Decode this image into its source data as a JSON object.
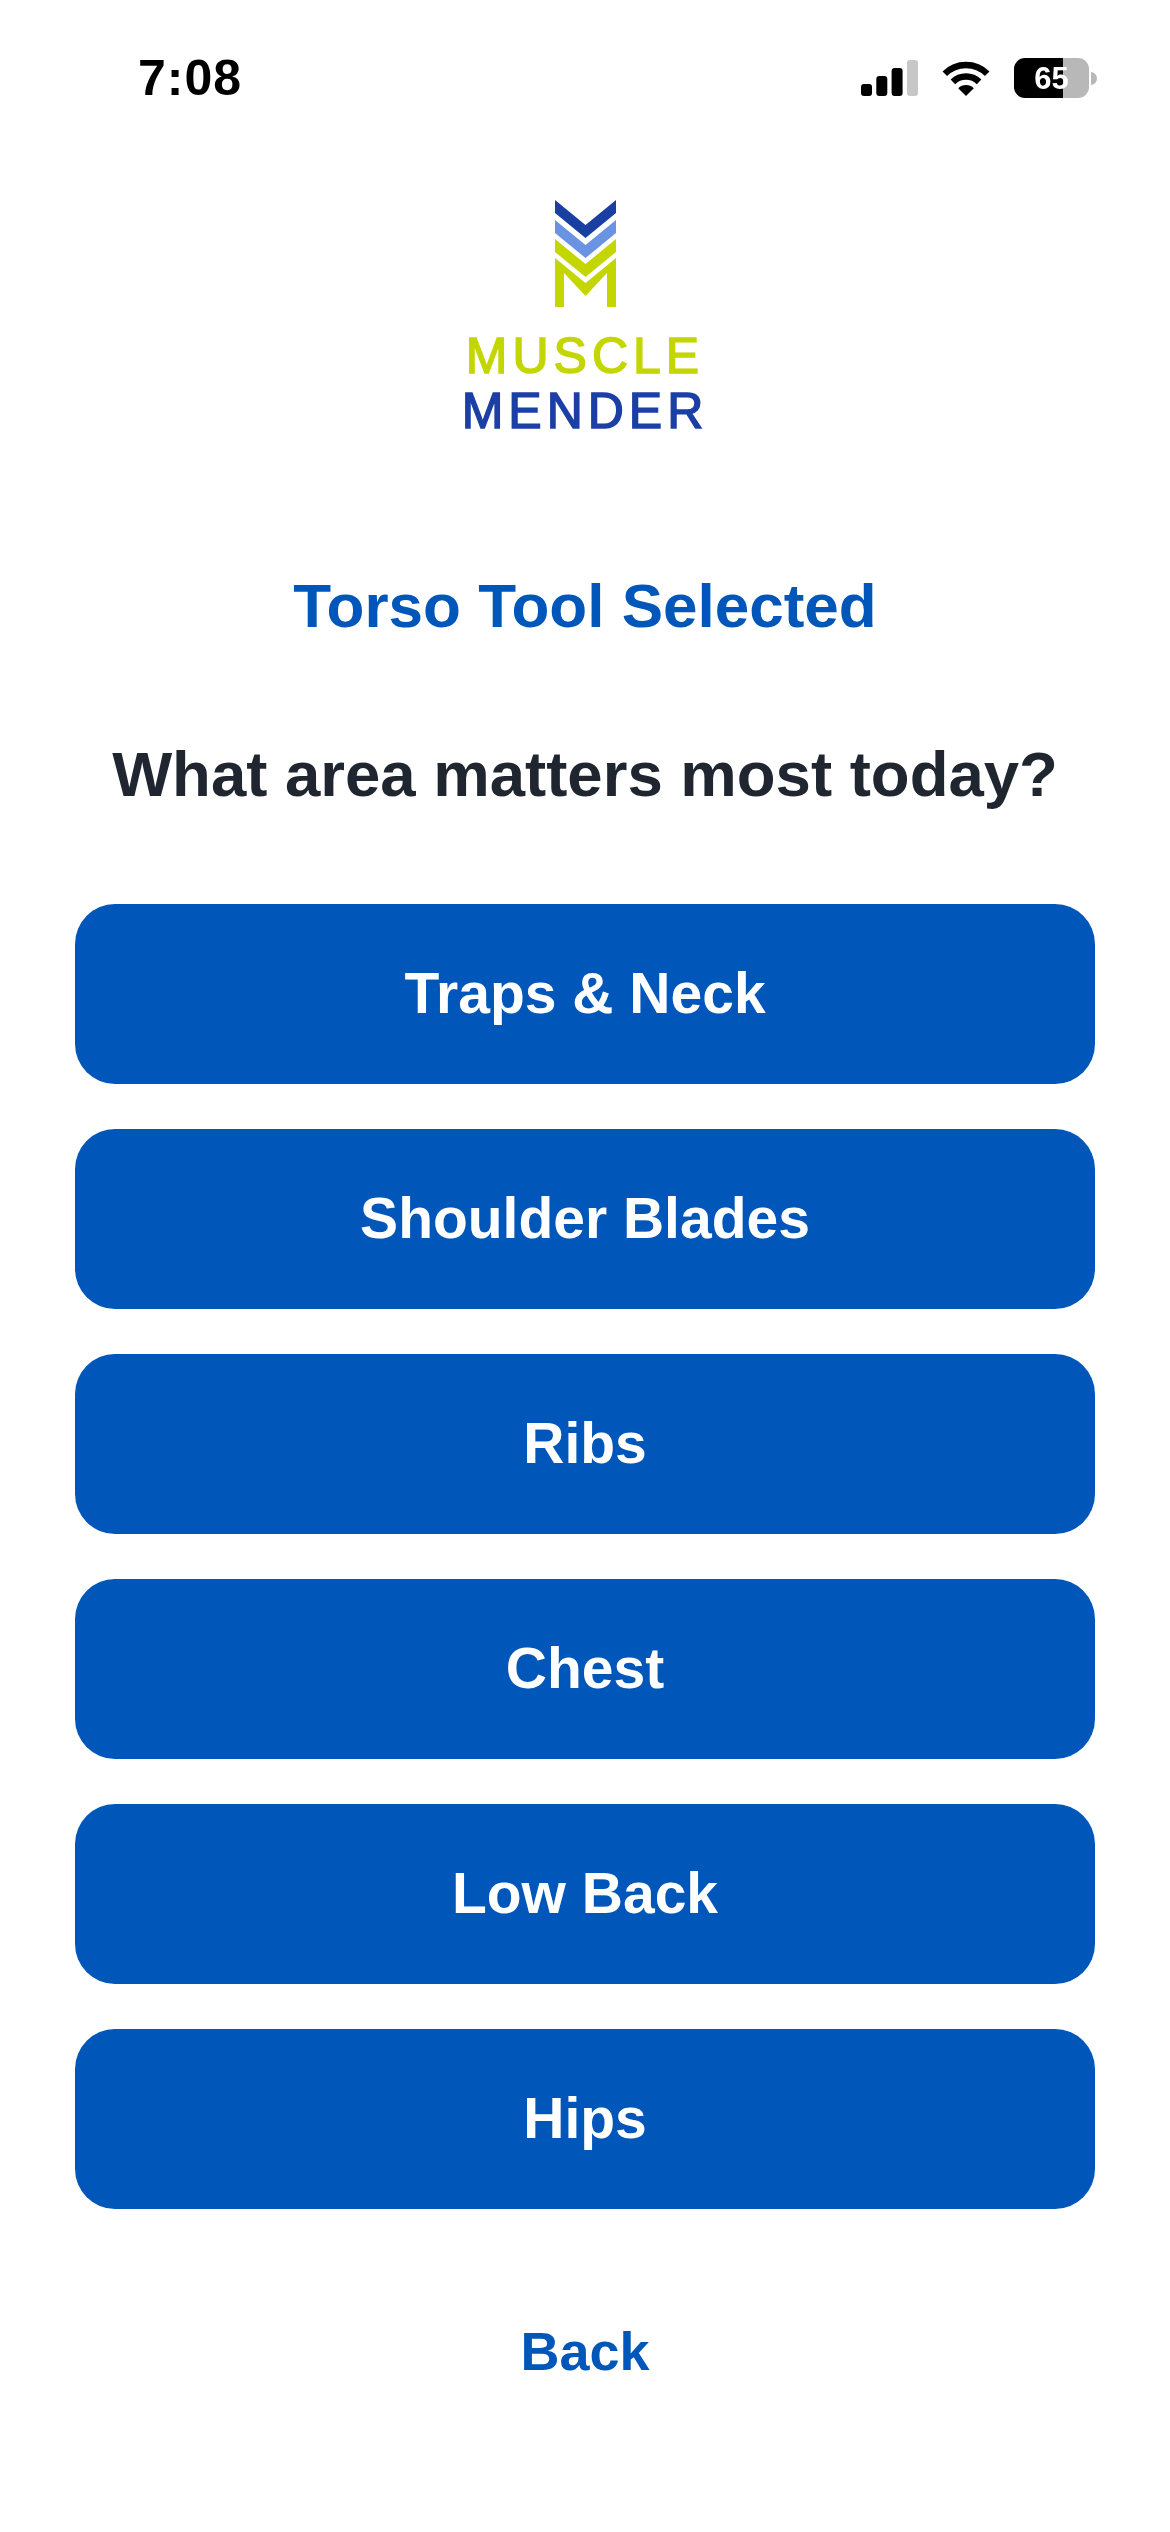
{
  "status_bar": {
    "time": "7:08",
    "battery": "65"
  },
  "logo": {
    "line_1": "MUSCLE",
    "line_2": "MENDER"
  },
  "title": "Torso Tool Selected",
  "question": "What area matters most today?",
  "options": [
    {
      "label": "Traps & Neck"
    },
    {
      "label": "Shoulder Blades"
    },
    {
      "label": "Ribs"
    },
    {
      "label": "Chest"
    },
    {
      "label": "Low Back"
    },
    {
      "label": "Hips"
    }
  ],
  "back": "Back"
}
